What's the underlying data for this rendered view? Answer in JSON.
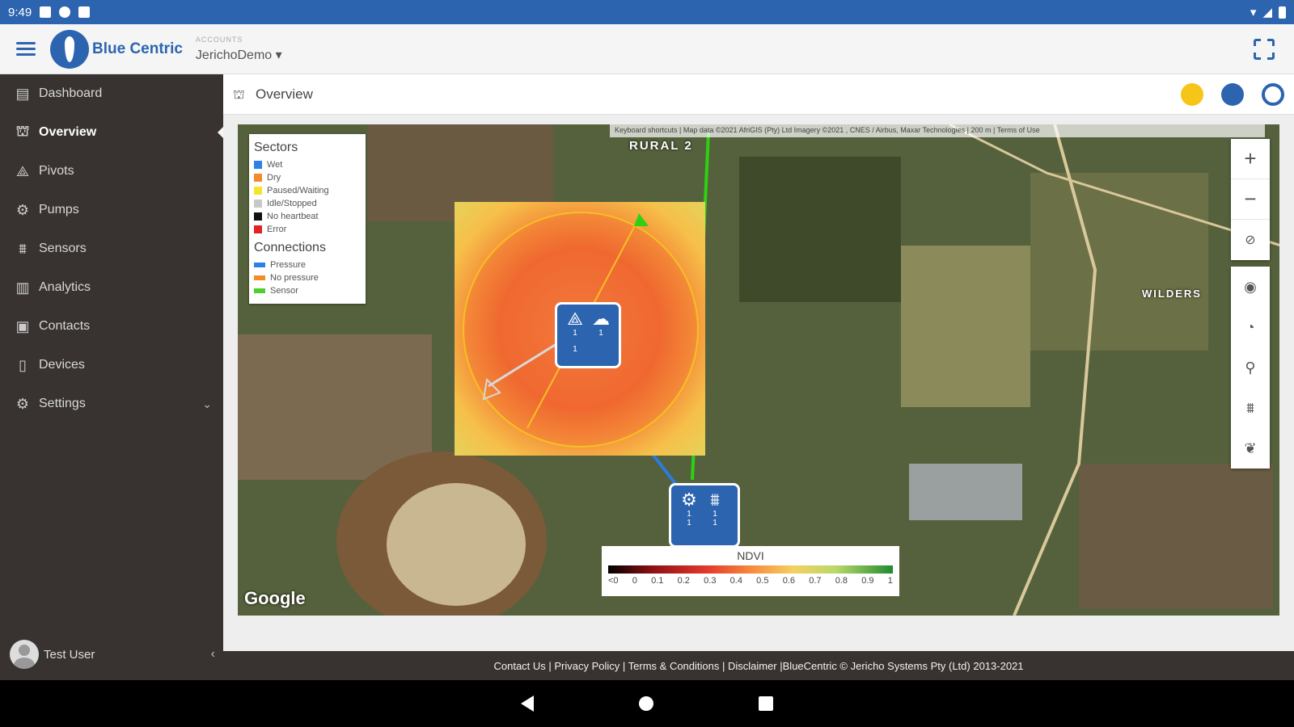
{
  "status_bar": {
    "time": "9:49"
  },
  "app": {
    "logo_text": "Blue Centric",
    "account_label": "ACCOUNTS",
    "account_value": "JerichoDemo ▾"
  },
  "sidebar": {
    "items": [
      {
        "label": "Dashboard",
        "icon": "dashboard-icon"
      },
      {
        "label": "Overview",
        "icon": "overview-icon"
      },
      {
        "label": "Pivots",
        "icon": "pivot-icon"
      },
      {
        "label": "Pumps",
        "icon": "pump-icon"
      },
      {
        "label": "Sensors",
        "icon": "sensor-icon"
      },
      {
        "label": "Analytics",
        "icon": "analytics-icon"
      },
      {
        "label": "Contacts",
        "icon": "contacts-icon"
      },
      {
        "label": "Devices",
        "icon": "devices-icon"
      },
      {
        "label": "Settings",
        "icon": "gear-icon"
      }
    ],
    "user_name": "Test User"
  },
  "page": {
    "title": "Overview"
  },
  "map": {
    "attribution": "Keyboard shortcuts | Map data ©2021 AfriGIS (Pty) Ltd Imagery ©2021 , CNES / Airbus, Maxar Technologies | 200 m | Terms of Use",
    "label_rural": "RURAL 2",
    "label_wilders": "WILDERS",
    "google": "Google",
    "legend": {
      "sectors_title": "Sectors",
      "sectors": [
        {
          "label": "Wet",
          "color": "#2f7fe8"
        },
        {
          "label": "Dry",
          "color": "#f58a2a"
        },
        {
          "label": "Paused/Waiting",
          "color": "#f5e42a"
        },
        {
          "label": "Idle/Stopped",
          "color": "#c8c8c8"
        },
        {
          "label": "No heartbeat",
          "color": "#111111"
        },
        {
          "label": "Error",
          "color": "#e32222"
        }
      ],
      "connections_title": "Connections",
      "connections": [
        {
          "label": "Pressure",
          "color": "#2f7fe8"
        },
        {
          "label": "No pressure",
          "color": "#f58a2a"
        },
        {
          "label": "Sensor",
          "color": "#4fcf2f"
        }
      ]
    },
    "ndvi": {
      "title": "NDVI",
      "ticks": [
        "<0",
        "0",
        "0.1",
        "0.2",
        "0.3",
        "0.4",
        "0.5",
        "0.6",
        "0.7",
        "0.8",
        "0.9",
        "1"
      ]
    },
    "pivot_card": {
      "a": "1",
      "b": "1",
      "c": "1"
    },
    "pump_card": {
      "a": "1",
      "b": "1",
      "c": "1",
      "d": "1"
    }
  },
  "footer": "Contact Us | Privacy Policy | Terms & Conditions | Disclaimer |BlueCentric © Jericho Systems Pty (Ltd) 2013-2021"
}
